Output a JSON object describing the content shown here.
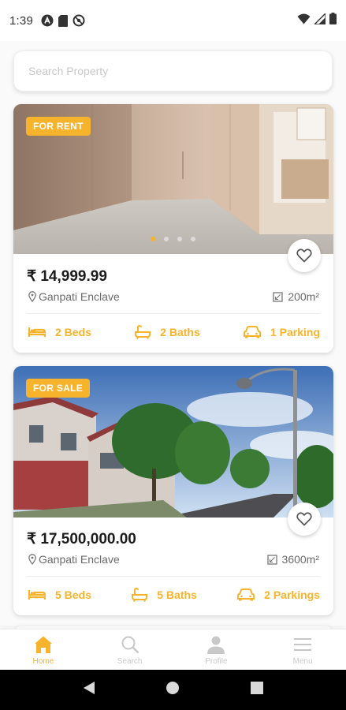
{
  "status_bar": {
    "time": "1:39",
    "left_icons": [
      "a-circle-icon",
      "sim-card-icon",
      "at-circle-icon"
    ],
    "right_icons": [
      "wifi-icon",
      "signal-icon",
      "battery-icon"
    ]
  },
  "search": {
    "placeholder": "Search Property",
    "value": ""
  },
  "listings": [
    {
      "badge": "FOR RENT",
      "price": "₹ 14,999.99",
      "location": "Ganpati Enclave",
      "area": "200m²",
      "beds": "2 Beds",
      "baths": "2 Baths",
      "parking": "1 Parking",
      "image_slides": 4,
      "active_slide": 1
    },
    {
      "badge": "FOR SALE",
      "price": "₹ 17,500,000.00",
      "location": "Ganpati Enclave",
      "area": "3600m²",
      "beds": "5 Beds",
      "baths": "5 Baths",
      "parking": "2 Parkings"
    }
  ],
  "bottom_nav": {
    "items": [
      {
        "label": "Home",
        "icon": "home-icon",
        "active": true
      },
      {
        "label": "Search",
        "icon": "search-icon",
        "active": false
      },
      {
        "label": "Profile",
        "icon": "person-icon",
        "active": false
      },
      {
        "label": "Menu",
        "icon": "menu-icon",
        "active": false
      }
    ]
  },
  "system_nav": {
    "buttons": [
      "back-icon",
      "home-circle-icon",
      "recents-icon"
    ]
  },
  "colors": {
    "accent": "#f7b32b",
    "text_primary": "#1c1c1c",
    "text_secondary": "#6b6b6b",
    "inactive": "#c8c8c8"
  }
}
